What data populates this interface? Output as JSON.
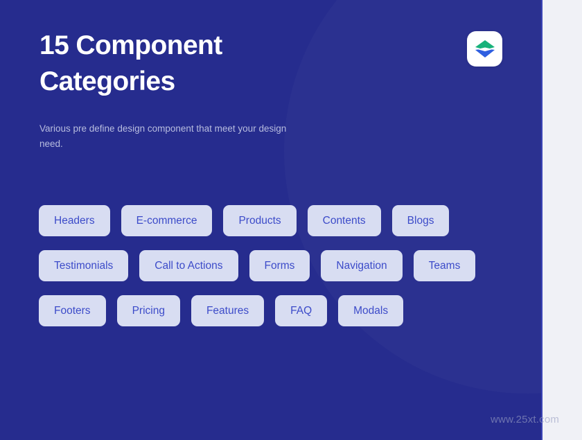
{
  "page": {
    "background_color": "#f0f1f6",
    "panel_color": "#262c8e",
    "accent_color": "#3c4bc9",
    "pill_background": "#d8ddf2"
  },
  "hero": {
    "title": "15 Component Categories",
    "subtitle": "Various pre define design component that meet your design need."
  },
  "logo": {
    "icon": "layers-stack-icon",
    "top_layer_color": "#19b27a",
    "bottom_layer_color": "#2f5fe0",
    "badge_color": "#ffffff"
  },
  "categories": {
    "rows": [
      [
        {
          "label": "Headers"
        },
        {
          "label": "E-commerce"
        },
        {
          "label": "Products"
        },
        {
          "label": "Contents"
        },
        {
          "label": "Blogs"
        }
      ],
      [
        {
          "label": "Testimonials"
        },
        {
          "label": "Call to Actions"
        },
        {
          "label": "Forms"
        },
        {
          "label": "Navigation"
        },
        {
          "label": "Teams"
        }
      ],
      [
        {
          "label": "Footers"
        },
        {
          "label": "Pricing"
        },
        {
          "label": "Features"
        },
        {
          "label": "FAQ"
        },
        {
          "label": "Modals"
        }
      ]
    ]
  },
  "watermark": {
    "text": "www.25xt.com"
  }
}
